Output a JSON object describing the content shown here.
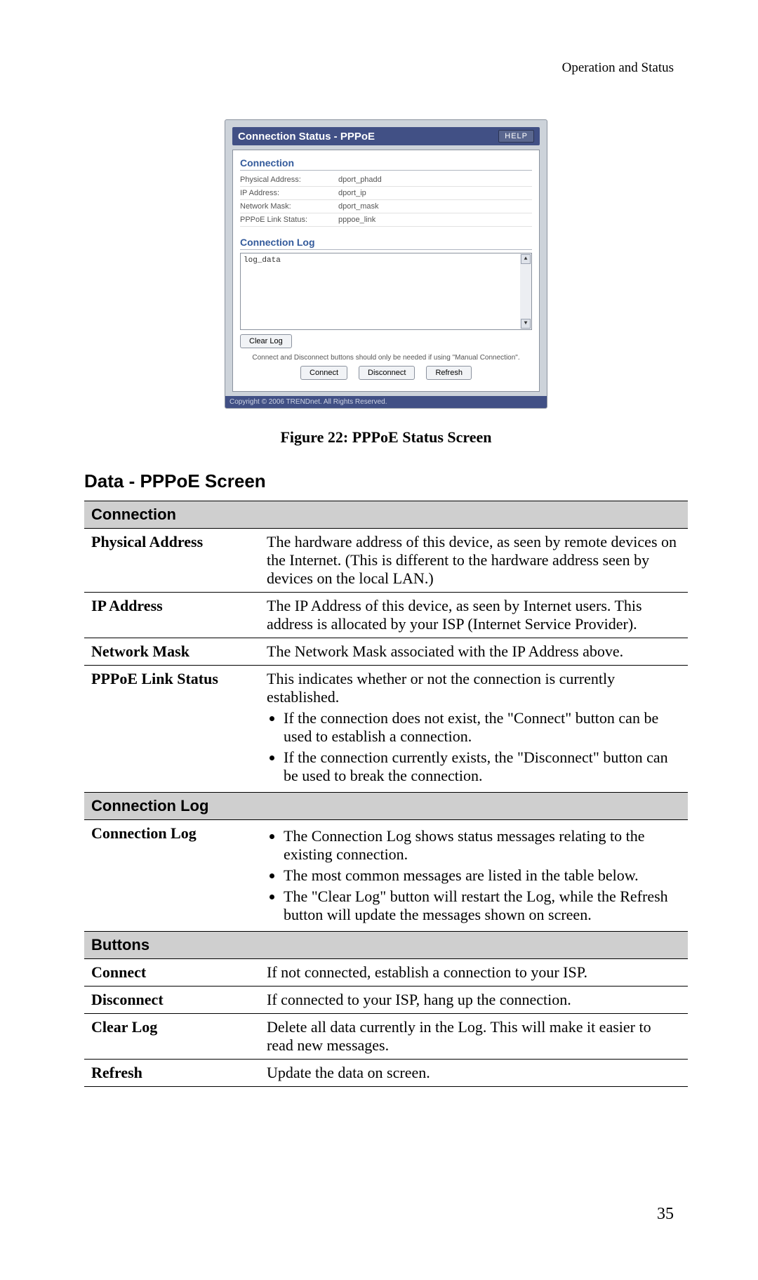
{
  "header": {
    "section": "Operation and Status"
  },
  "page_number": "35",
  "dialog": {
    "title": "Connection Status - PPPoE",
    "help_label": "HELP",
    "connection_title": "Connection",
    "rows": [
      {
        "label": "Physical Address:",
        "value": "dport_phadd"
      },
      {
        "label": "IP Address:",
        "value": "dport_ip"
      },
      {
        "label": "Network Mask:",
        "value": "dport_mask"
      },
      {
        "label": "PPPoE Link Status:",
        "value": "pppoe_link"
      }
    ],
    "log_title": "Connection Log",
    "log_data": "log_data",
    "clear_log_label": "Clear Log",
    "note": "Connect and Disconnect buttons should only be needed if using \"Manual Connection\".",
    "connect_label": "Connect",
    "disconnect_label": "Disconnect",
    "refresh_label": "Refresh",
    "copyright": "Copyright © 2006 TRENDnet. All Rights Reserved."
  },
  "caption": "Figure 22: PPPoE Status Screen",
  "data_title": "Data - PPPoE Screen",
  "table": {
    "section1": "Connection",
    "r1k": "Physical Address",
    "r1v": "The hardware address of this device, as seen by remote devices on the Internet. (This is different to the hardware address seen by devices on the local LAN.)",
    "r2k": "IP Address",
    "r2v": "The IP Address of this device, as seen by Internet users. This address is allocated by your ISP (Internet Service Provider).",
    "r3k": "Network Mask",
    "r3v": "The Network Mask associated with the IP Address above.",
    "r4k": "PPPoE Link Status",
    "r4v_intro": "This indicates whether or not the connection is currently established.",
    "r4v_li1": "If the connection does not exist, the \"Connect\" button can be used to establish a connection.",
    "r4v_li2": "If the connection currently exists, the \"Disconnect\" button can be used to break the connection.",
    "section2": "Connection Log",
    "r5k": "Connection Log",
    "r5v_li1": "The Connection Log shows status messages relating to the existing connection.",
    "r5v_li2": "The most common messages are listed in the table below.",
    "r5v_li3": "The \"Clear Log\" button will restart the Log, while the Refresh button will update the messages shown on screen.",
    "section3": "Buttons",
    "r6k": "Connect",
    "r6v": "If not connected, establish a connection to your ISP.",
    "r7k": "Disconnect",
    "r7v": "If connected to your ISP, hang up the connection.",
    "r8k": "Clear Log",
    "r8v": "Delete all data currently in the Log. This will make it easier to read new messages.",
    "r9k": "Refresh",
    "r9v": "Update the data on screen."
  }
}
